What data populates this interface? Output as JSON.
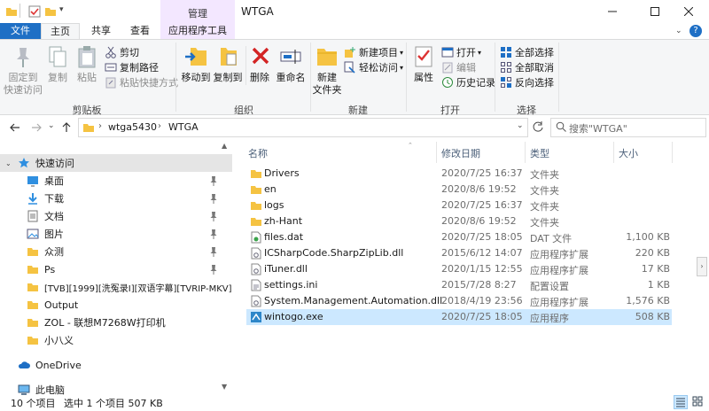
{
  "window": {
    "title": "WTGA",
    "context_tab_group": "管理",
    "colors": {
      "file_tab": "#1e6fc5",
      "context_band": "#f3e7ff",
      "selection": "#cce8ff",
      "folder": "#f5c342"
    }
  },
  "tabs": {
    "file": "文件",
    "home": "主页",
    "share": "共享",
    "view": "查看",
    "app_tools": "应用程序工具"
  },
  "ribbon": {
    "clipboard": {
      "pin_quick": "固定到",
      "pin_quick2": "快速访问",
      "copy": "复制",
      "paste": "粘贴",
      "cut": "剪切",
      "copy_path": "复制路径",
      "paste_shortcut": "粘贴快捷方式",
      "label": "剪贴板"
    },
    "organize": {
      "move_to": "移动到",
      "copy_to": "复制到",
      "delete": "删除",
      "rename": "重命名",
      "label": "组织"
    },
    "new": {
      "new_folder1": "新建",
      "new_folder2": "文件夹",
      "new_item": "新建项目",
      "easy_access": "轻松访问",
      "label": "新建"
    },
    "open": {
      "properties": "属性",
      "open": "打开",
      "edit": "编辑",
      "history": "历史记录",
      "label": "打开"
    },
    "select": {
      "select_all": "全部选择",
      "select_none": "全部取消",
      "invert": "反向选择",
      "label": "选择"
    }
  },
  "address": {
    "crumbs": [
      "wtga5430",
      "WTGA"
    ],
    "search_placeholder": "搜索\"WTGA\""
  },
  "nav": {
    "quick_access": "快速访问",
    "items": [
      {
        "label": "桌面",
        "pinned": true,
        "icon": "desktop-icon"
      },
      {
        "label": "下载",
        "pinned": true,
        "icon": "download-icon"
      },
      {
        "label": "文档",
        "pinned": true,
        "icon": "document-icon"
      },
      {
        "label": "图片",
        "pinned": true,
        "icon": "picture-icon"
      },
      {
        "label": "众测",
        "pinned": true,
        "icon": "folder-icon"
      },
      {
        "label": "Ps",
        "pinned": true,
        "icon": "folder-icon"
      },
      {
        "label": "[TVB][1999][洗冤录I][双语字幕][TVRIP-MKV]",
        "pinned": false,
        "icon": "folder-icon"
      },
      {
        "label": "Output",
        "pinned": false,
        "icon": "folder-icon"
      },
      {
        "label": "ZOL - 联想M7268W打印机",
        "pinned": false,
        "icon": "folder-icon"
      },
      {
        "label": "小八义",
        "pinned": false,
        "icon": "folder-icon"
      }
    ],
    "onedrive": "OneDrive",
    "this_pc": "此电脑"
  },
  "list": {
    "headers": {
      "name": "名称",
      "modified": "修改日期",
      "type": "类型",
      "size": "大小"
    },
    "rows": [
      {
        "name": "Drivers",
        "modified": "2020/7/25 16:37",
        "type": "文件夹",
        "size": "",
        "icon": "folder-icon"
      },
      {
        "name": "en",
        "modified": "2020/8/6 19:52",
        "type": "文件夹",
        "size": "",
        "icon": "folder-icon"
      },
      {
        "name": "logs",
        "modified": "2020/7/25 16:37",
        "type": "文件夹",
        "size": "",
        "icon": "folder-icon"
      },
      {
        "name": "zh-Hant",
        "modified": "2020/8/6 19:52",
        "type": "文件夹",
        "size": "",
        "icon": "folder-icon"
      },
      {
        "name": "files.dat",
        "modified": "2020/7/25 18:05",
        "type": "DAT 文件",
        "size": "1,100 KB",
        "icon": "dat-file-icon"
      },
      {
        "name": "ICSharpCode.SharpZipLib.dll",
        "modified": "2015/6/12 14:07",
        "type": "应用程序扩展",
        "size": "220 KB",
        "icon": "dll-file-icon"
      },
      {
        "name": "iTuner.dll",
        "modified": "2020/1/15 12:55",
        "type": "应用程序扩展",
        "size": "17 KB",
        "icon": "dll-file-icon"
      },
      {
        "name": "settings.ini",
        "modified": "2015/7/28 8:27",
        "type": "配置设置",
        "size": "1 KB",
        "icon": "ini-file-icon"
      },
      {
        "name": "System.Management.Automation.dll",
        "modified": "2018/4/19 23:56",
        "type": "应用程序扩展",
        "size": "1,576 KB",
        "icon": "dll-file-icon"
      },
      {
        "name": "wintogo.exe",
        "modified": "2020/7/25 18:05",
        "type": "应用程序",
        "size": "508 KB",
        "icon": "exe-file-icon",
        "selected": true
      }
    ]
  },
  "status": {
    "count": "10 个项目",
    "selected": "选中 1 个项目  507 KB"
  }
}
